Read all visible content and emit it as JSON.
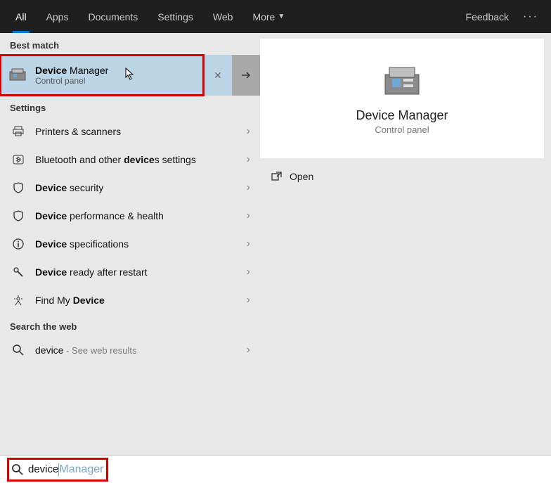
{
  "topbar": {
    "tabs": [
      "All",
      "Apps",
      "Documents",
      "Settings",
      "Web",
      "More"
    ],
    "feedback": "Feedback"
  },
  "left": {
    "best_match_label": "Best match",
    "best": {
      "title_bold": "Device",
      "title_rest": " Manager",
      "subtitle": "Control panel"
    },
    "settings_label": "Settings",
    "settings_items": [
      {
        "icon": "printer",
        "pre": "",
        "bold": "",
        "post": "Printers & scanners"
      },
      {
        "icon": "bluetooth",
        "pre": "Bluetooth and other ",
        "bold": "device",
        "post": "s settings"
      },
      {
        "icon": "shield",
        "pre": "",
        "bold": "Device",
        "post": " security"
      },
      {
        "icon": "shield",
        "pre": "",
        "bold": "Device",
        "post": " performance & health"
      },
      {
        "icon": "info",
        "pre": "",
        "bold": "Device",
        "post": " specifications"
      },
      {
        "icon": "wrench",
        "pre": "",
        "bold": "Device",
        "post": " ready after restart"
      },
      {
        "icon": "locate",
        "pre": "Find My ",
        "bold": "Device",
        "post": ""
      }
    ],
    "web_label": "Search the web",
    "web_item": {
      "query": "device",
      "suffix": " - See web results"
    }
  },
  "preview": {
    "title": "Device Manager",
    "subtitle": "Control panel",
    "open": "Open"
  },
  "search": {
    "typed": "device",
    "ghost": " Manager"
  }
}
